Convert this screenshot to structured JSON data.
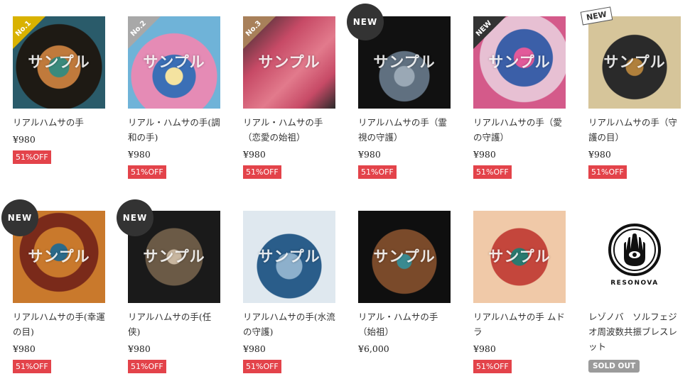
{
  "watermark": "サンプル",
  "products": [
    {
      "title": "リアルハムサの手",
      "price": "¥980",
      "discount": "51%OFF",
      "badge": "No.1",
      "art": [
        "#1e1a14",
        "#2a5b6a",
        "#c07a3c"
      ]
    },
    {
      "title": "リアル・ハムサの手(調和の手)",
      "price": "¥980",
      "discount": "51%OFF",
      "badge": "No.2",
      "art": [
        "#e58bb5",
        "#3b6fb6",
        "#f2c070"
      ]
    },
    {
      "title": "リアル・ハムサの手（恋愛の始祖）",
      "price": "¥980",
      "discount": "51%OFF",
      "badge": "No.3",
      "art": [
        "#c74a66",
        "#e27a8c",
        "#2a2a2a"
      ]
    },
    {
      "title": "リアルハムサの手（霊視の守護）",
      "price": "¥980",
      "discount": "51%OFF",
      "badge": "NEW",
      "art": [
        "#111",
        "#607080",
        "#9aa8b5"
      ]
    },
    {
      "title": "リアルハムサの手（愛の守護）",
      "price": "¥980",
      "discount": "51%OFF",
      "badge": "NEW",
      "art": [
        "#d45a8a",
        "#3b5fa8",
        "#e7c0d3"
      ]
    },
    {
      "title": "リアルハムサの手（守護の目）",
      "price": "¥980",
      "discount": "51%OFF",
      "badge": "NEW",
      "art": [
        "#d6c59a",
        "#2a2a2a",
        "#b0803c"
      ]
    },
    {
      "title": "リアルハムサの手(幸運の目)",
      "price": "¥980",
      "discount": "51%OFF",
      "badge": "NEW",
      "art": [
        "#c9792c",
        "#7a2a1a",
        "#2a6a8a"
      ]
    },
    {
      "title": "リアルハムサの手(任侠)",
      "price": "¥980",
      "discount": "51%OFF",
      "badge": "NEW",
      "art": [
        "#1a1a1a",
        "#6b5a46",
        "#c9b7a0"
      ]
    },
    {
      "title": "リアルハムサの手(水流の守護)",
      "price": "¥980",
      "discount": "51%OFF",
      "badge": "",
      "art": [
        "#dfe8ef",
        "#2a5d8a",
        "#8db0cc"
      ]
    },
    {
      "title": "リアル・ハムサの手（始祖）",
      "price": "¥6,000",
      "discount": "",
      "badge": "",
      "art": [
        "#0f0f0f",
        "#7a4a2a",
        "#3a8a90"
      ]
    },
    {
      "title": "リアルハムサの手 ムドラ",
      "price": "¥980",
      "discount": "51%OFF",
      "badge": "",
      "art": [
        "#f0c9a8",
        "#c4463c",
        "#2a7a70"
      ]
    },
    {
      "title": "レゾノバ　ソルフェジオ周波数共振ブレスレット",
      "price": "",
      "discount": "",
      "badge": "",
      "sold_out": "SOLD OUT",
      "logo_text": "RESONOVA",
      "art": [
        "#ffffff",
        "#ffffff",
        "#ffffff"
      ]
    }
  ]
}
